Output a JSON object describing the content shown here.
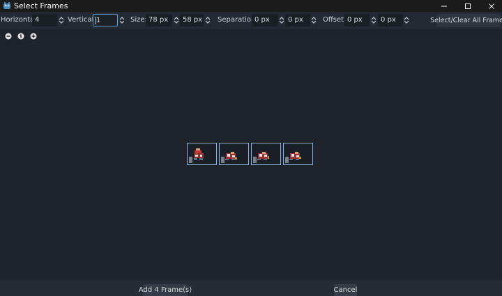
{
  "window": {
    "title": "Select Frames",
    "app_icon": "godot-icon"
  },
  "toolbar": {
    "horizontal_label": "Horizontal:",
    "horizontal_value": "4",
    "vertical_label": "Vertical:",
    "vertical_value": "1",
    "size_label": "Size:",
    "size_x": "78 px",
    "size_y": "58 px",
    "separation_label": "Separation:",
    "separation_x": "0 px",
    "separation_y": "0 px",
    "offset_label": "Offset:",
    "offset_x": "0 px",
    "offset_y": "0 px",
    "select_all_label": "Select/Clear All Frames"
  },
  "zoom": {
    "icons": [
      "zoom-out-icon",
      "zoom-reset-icon",
      "zoom-in-icon"
    ]
  },
  "frames": {
    "count": 4,
    "selected": [
      true,
      true,
      true,
      true
    ]
  },
  "footer": {
    "add_label": "Add 4 Frame(s)",
    "cancel_label": "Cancel"
  },
  "colors": {
    "accent": "#5e9bd8",
    "selection": "#8ab4e6",
    "panel": "#1f242c",
    "toolbar": "#242a33"
  }
}
